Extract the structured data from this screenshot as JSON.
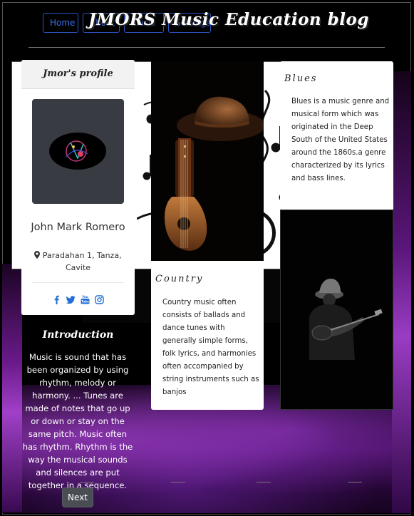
{
  "nav": {
    "items": [
      {
        "label": "Home"
      },
      {
        "label": "About"
      },
      {
        "label": "Music"
      },
      {
        "label": "Settings"
      }
    ]
  },
  "site": {
    "title": "JMORS Music Education blog"
  },
  "profile": {
    "heading": "Jmor's profile",
    "name": "John Mark Romero",
    "location": "Paradahan 1, Tanza, Cavite",
    "socials": [
      "facebook-icon",
      "twitter-icon",
      "youtube-icon",
      "instagram-icon"
    ]
  },
  "intro": {
    "title": "Introduction",
    "text": "Music is sound that has been organized by using rhythm, melody or harmony. ... Tunes are made of notes that go up or down or stay on the same pitch. Music often has rhythm. Rhythm is the way the musical sounds and silences are put together in a sequence.",
    "next_label": "Next"
  },
  "country": {
    "title": "Country",
    "text": "Country music often consists of ballads and dance tunes with generally simple forms, folk lyrics, and harmonies often accompanied by string instruments such as banjos"
  },
  "blues": {
    "title": "Blues",
    "text": "Blues is a music genre and musical form which was originated in the Deep South of the United States around the 1860s.a genre characterized by its lyrics and bass lines."
  },
  "colors": {
    "nav_accent": "#3b6ff0",
    "background": "#000000",
    "purple_glow": "#a040c8",
    "next_button": "#4a4e54"
  }
}
